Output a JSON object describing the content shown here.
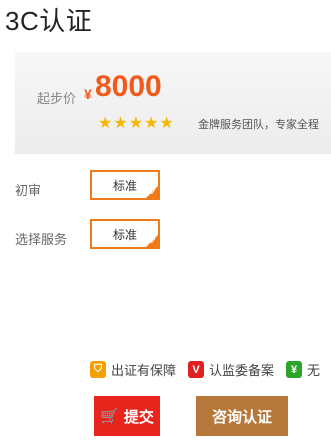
{
  "page": {
    "title": "3C认证"
  },
  "price": {
    "label": "起步价",
    "currency": "¥",
    "value": "8000",
    "rating_stars": 5,
    "description": "金牌服务团队，专家全程"
  },
  "options": [
    {
      "label": "初审",
      "value": "标准"
    },
    {
      "label": "选择服务",
      "value": "标准"
    }
  ],
  "guarantees": [
    {
      "icon": "shield-icon",
      "text": "出证有保障"
    },
    {
      "icon": "verified-icon",
      "text": "认监委备案"
    },
    {
      "icon": "yuan-icon",
      "text": "无"
    }
  ],
  "buttons": {
    "submit_label": "提交",
    "consult_label": "咨询认证"
  },
  "colors": {
    "accent": "#f05a1a",
    "option_border": "#f07a1a",
    "submit": "#e8251c",
    "consult": "#b5773a",
    "star": "#f5b800"
  }
}
